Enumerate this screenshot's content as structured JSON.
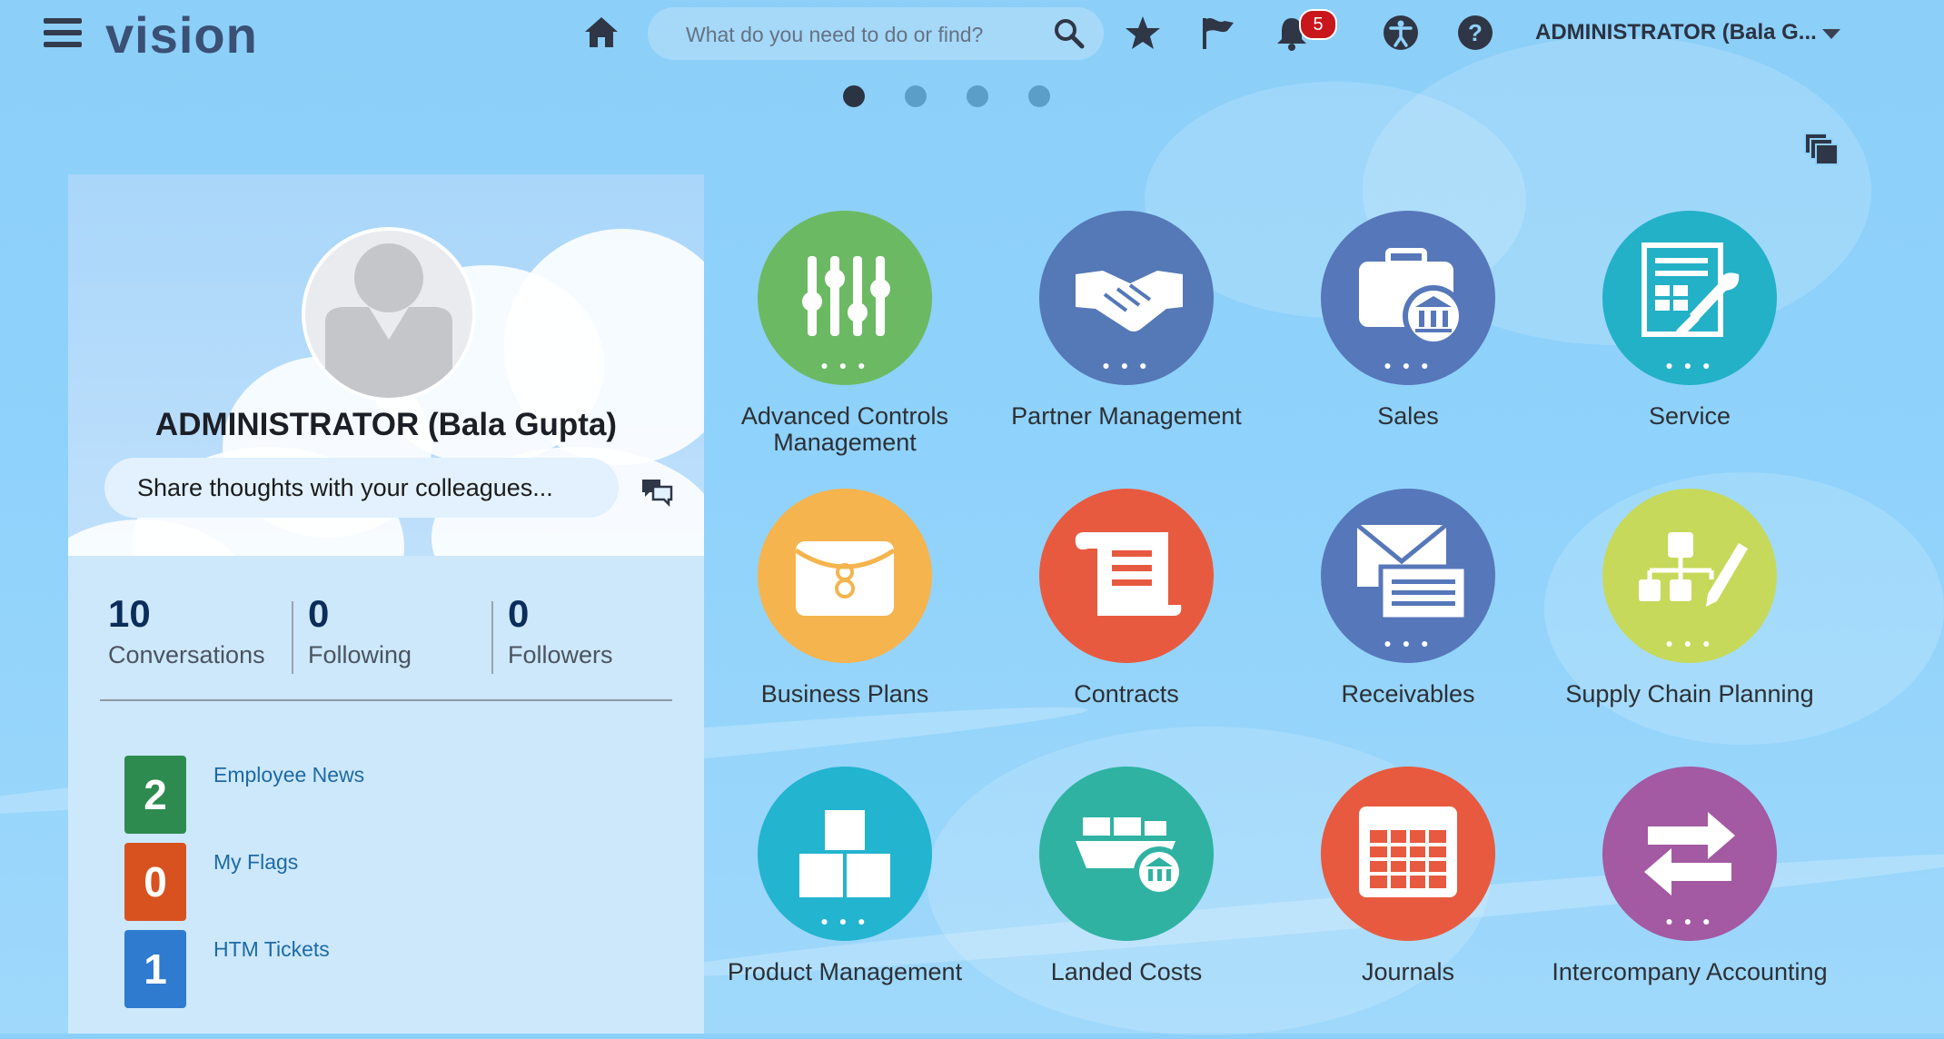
{
  "header": {
    "logo": "vision",
    "search_placeholder": "What do you need to do or find?",
    "notifications_count": "5",
    "user_menu": "ADMINISTRATOR (Bala G..."
  },
  "icons": {
    "menu": "hamburger-menu-icon",
    "home": "home-icon",
    "search": "search-icon",
    "favorites": "star-icon",
    "flags": "flag-icon",
    "notifications": "bell-icon",
    "accessibility": "accessibility-icon",
    "help": "help-icon",
    "cards": "stacked-cards-icon",
    "share": "conversation-bubbles-icon"
  },
  "carousel": {
    "pages": 4,
    "active": 1
  },
  "profile": {
    "name": "ADMINISTRATOR (Bala Gupta)",
    "share_placeholder": "Share thoughts with your colleagues...",
    "stats": [
      {
        "value": "10",
        "label": "Conversations"
      },
      {
        "value": "0",
        "label": "Following"
      },
      {
        "value": "0",
        "label": "Followers"
      }
    ],
    "counters": [
      {
        "count": "2",
        "label": "Employee News",
        "color": "#2e8b4f"
      },
      {
        "count": "0",
        "label": "My Flags",
        "color": "#d8521f"
      },
      {
        "count": "1",
        "label": "HTM Tickets",
        "color": "#2e7bd0"
      }
    ]
  },
  "apps": [
    {
      "label": "Advanced Controls Management",
      "color": "#6cb963",
      "icon": "sliders-icon"
    },
    {
      "label": "Partner Management",
      "color": "#5578b7",
      "icon": "handshake-icon"
    },
    {
      "label": "Sales",
      "color": "#5677b9",
      "icon": "briefcase-bank-icon"
    },
    {
      "label": "Service",
      "color": "#23b1c7",
      "icon": "form-wrench-icon"
    },
    {
      "label": "Business Plans",
      "color": "#f5b44d",
      "icon": "satchel-icon"
    },
    {
      "label": "Contracts",
      "color": "#e85a3f",
      "icon": "scroll-icon"
    },
    {
      "label": "Receivables",
      "color": "#5677b9",
      "icon": "envelope-invoice-icon"
    },
    {
      "label": "Supply Chain Planning",
      "color": "#c7d95a",
      "icon": "org-chart-pencil-icon"
    },
    {
      "label": "Product Management",
      "color": "#23b4cf",
      "icon": "boxes-icon"
    },
    {
      "label": "Landed Costs",
      "color": "#2fb2a2",
      "icon": "cargo-ship-icon"
    },
    {
      "label": "Journals",
      "color": "#e85a3f",
      "icon": "ledger-grid-icon"
    },
    {
      "label": "Intercompany Accounting",
      "color": "#a35aa2",
      "icon": "exchange-arrows-icon"
    }
  ]
}
